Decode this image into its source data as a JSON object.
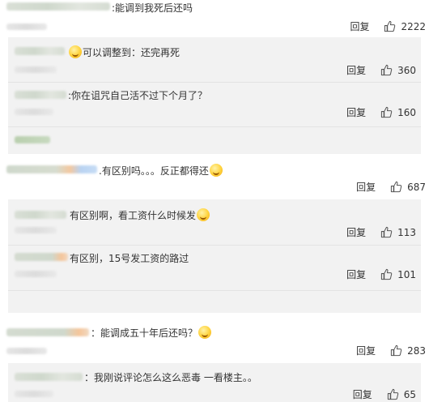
{
  "comments": [
    {
      "text": "能调到我死后还吗",
      "reply_label": "回复",
      "likes": "2222"
    },
    {
      "text": "可以调整到：还完再死",
      "reply_label": "回复",
      "likes": "360"
    },
    {
      "text": "你在诅咒自己活不过下个月了？",
      "reply_label": "回复",
      "likes": "160"
    },
    {
      "text": ".有区别吗。。。反正都得还",
      "reply_label": "回复",
      "likes": "687"
    },
    {
      "text": "有区别啊，看工资什么时候发",
      "reply_label": "回复",
      "likes": "113"
    },
    {
      "text": "有区别，15号发工资的路过",
      "reply_label": "回复",
      "likes": "101"
    },
    {
      "text": "：能调成五十年后还吗？",
      "reply_label": "回复",
      "likes": "283"
    },
    {
      "text": "：我刚说评论怎么这么恶毒  一看楼主。。",
      "reply_label": "回复",
      "likes": "65"
    }
  ],
  "separators": [
    ":",
    ":"
  ],
  "icons": {
    "like": "thumbs-up-icon",
    "emoji": "emoji-face-icon"
  },
  "colors": {
    "sub_background": "#f2f2f2",
    "text": "#333333"
  }
}
